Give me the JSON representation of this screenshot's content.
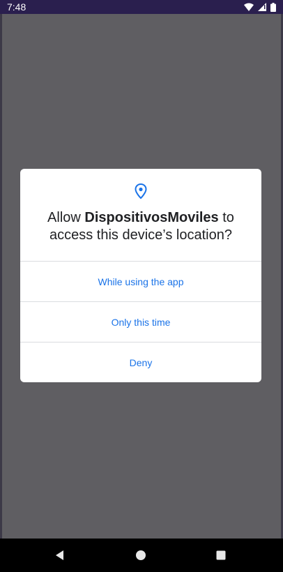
{
  "status_bar": {
    "time": "7:48",
    "icons": [
      "wifi-icon",
      "signal-icon",
      "battery-icon"
    ]
  },
  "dialog": {
    "icon": "location-pin-icon",
    "title_prefix": "Allow ",
    "app_name": "DispositivosMoviles",
    "title_suffix": " to access this device’s location?",
    "options": [
      {
        "label": "While using the app"
      },
      {
        "label": "Only this time"
      },
      {
        "label": "Deny"
      }
    ]
  },
  "nav_bar": {
    "buttons": [
      "back-icon",
      "home-icon",
      "recents-icon"
    ]
  },
  "colors": {
    "accent": "#1a73e8",
    "scrim": "#5f5e62",
    "status_bar": "#2a1f4e",
    "dialog_bg": "#ffffff"
  }
}
